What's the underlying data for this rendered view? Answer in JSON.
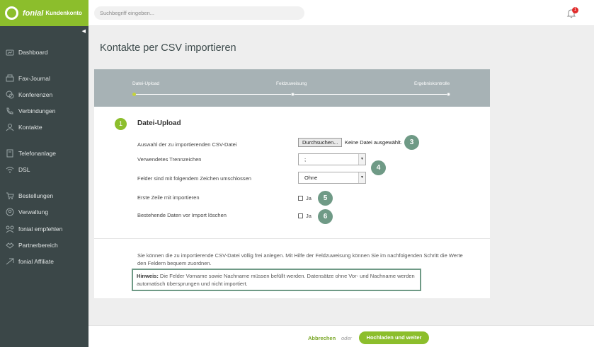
{
  "brand": {
    "name": "fonial",
    "subtitle": "Kundenkonto"
  },
  "sidebar": {
    "collapse_glyph": "◀",
    "items": [
      {
        "label": "Dashboard",
        "icon": "dashboard-icon"
      },
      {
        "label": "Fax-Journal",
        "icon": "fax-icon"
      },
      {
        "label": "Konferenzen",
        "icon": "conference-icon"
      },
      {
        "label": "Verbindungen",
        "icon": "phone-icon"
      },
      {
        "label": "Kontakte",
        "icon": "contacts-icon"
      },
      {
        "label": "Telefonanlage",
        "icon": "pbx-icon"
      },
      {
        "label": "DSL",
        "icon": "wifi-icon"
      },
      {
        "label": "Bestellungen",
        "icon": "cart-icon"
      },
      {
        "label": "Verwaltung",
        "icon": "admin-icon"
      },
      {
        "label": "fonial empfehlen",
        "icon": "recommend-icon"
      },
      {
        "label": "Partnerbereich",
        "icon": "partner-icon"
      },
      {
        "label": "fonial Affiliate",
        "icon": "affiliate-icon"
      }
    ]
  },
  "header": {
    "search_placeholder": "Suchbegriff eingeben...",
    "notification_count": "1"
  },
  "page": {
    "title": "Kontakte per CSV importieren"
  },
  "steps": [
    {
      "label": "Datei-Upload",
      "active": true
    },
    {
      "label": "Feldzuweisung",
      "active": false
    },
    {
      "label": "Ergebniskontrolle",
      "active": false
    }
  ],
  "section": {
    "number": "1",
    "title": "Datei-Upload"
  },
  "form": {
    "file_label": "Auswahl der zu importierenden CSV-Datei",
    "file_button": "Durchsuchen...",
    "file_status": "Keine Datei ausgewählt.",
    "separator_label": "Verwendetes Trennzeichen",
    "separator_value": ";",
    "enclosure_label": "Felder sind mit folgendem Zeichen umschlossen",
    "enclosure_value": "Ohne",
    "first_row_label": "Erste Zeile mit importieren",
    "first_row_check": "Ja",
    "delete_label": "Bestehende Daten vor Import löschen",
    "delete_check": "Ja"
  },
  "badges": {
    "b3": "3",
    "b4": "4",
    "b5": "5",
    "b6": "6"
  },
  "info": {
    "text": "Sie können die zu importierende CSV-Datei völlig frei anlegen. Mit Hilfe der Feldzuweisung können Sie im nachfolgenden Schritt die Werte den Feldern bequem zuordnen.",
    "hint_label": "Hinweis:",
    "hint_text": " Die Felder Vorname sowie Nachname müssen befüllt werden. Datensätze ohne Vor- und Nachname werden automatisch übersprungen und nicht importiert."
  },
  "footer": {
    "cancel": "Abbrechen",
    "or": "oder",
    "submit": "Hochladen und weiter"
  },
  "colors": {
    "brand_green": "#8cbe2c",
    "sidebar": "#3b4748",
    "badge": "#6f9a86",
    "steps_bar": "#a7b2b5"
  }
}
